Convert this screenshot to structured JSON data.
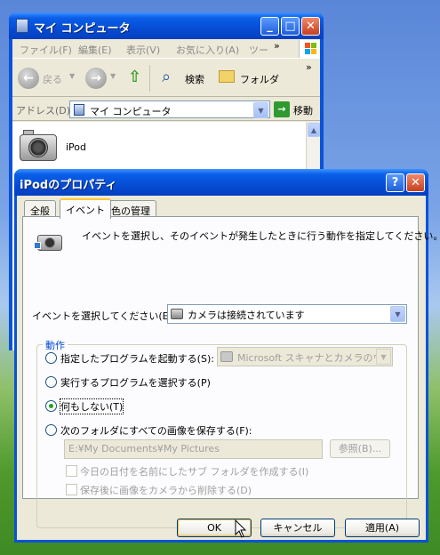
{
  "back_window": {
    "title": "マイ コンピュータ",
    "menu": [
      "ファイル(F)",
      "編集(E)",
      "表示(V)",
      "お気に入り(A)",
      "ツー"
    ],
    "menu_more": "»",
    "toolbar": {
      "back": "戻る",
      "search": "検索",
      "folders": "フォルダ",
      "more": "»"
    },
    "address_label": "アドレス(D)",
    "address_value": "マイ コンピュータ",
    "go_label": "移動",
    "item_label": "iPod"
  },
  "dialog": {
    "title": "iPodのプロパティ",
    "help_button": "?",
    "close_button": "✕",
    "tabs": [
      "全般",
      "イベント",
      "色の管理"
    ],
    "selected_tab": "イベント",
    "description": "イベントを選択し、そのイベントが発生したときに行う動作を指定してください。",
    "event_label": "イベントを選択してください(E):",
    "event_value": "カメラは接続されています",
    "action_group": "動作",
    "options": {
      "start_program": "指定したプログラムを起動する(S):",
      "start_program_value": "Microsoft スキャナとカメラのウィザ",
      "choose_program": "実行するプログラムを選択する(P)",
      "do_nothing": "何もしない(T)",
      "save_all": "次のフォルダにすべての画像を保存する(F):",
      "folder_path": "E:¥My Documents¥My Pictures",
      "browse": "参照(B)...",
      "subfolder": "今日の日付を名前にしたサブ フォルダを作成する(I)",
      "delete_after": "保存後に画像をカメラから削除する(D)"
    },
    "selected_option": "do_nothing",
    "buttons": {
      "ok": "OK",
      "cancel": "キャンセル",
      "apply": "適用(A)"
    }
  }
}
